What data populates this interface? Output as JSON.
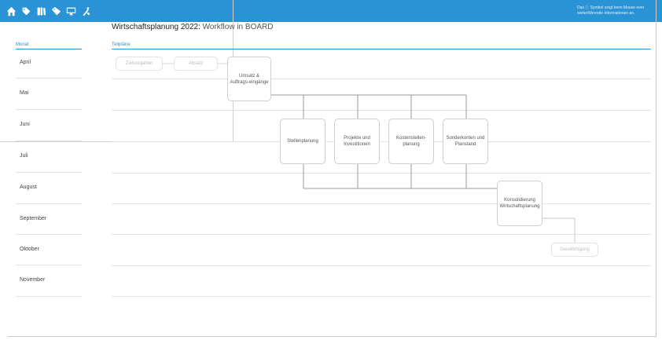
{
  "toolbar": {
    "icons": [
      "home-icon",
      "tag-icon",
      "book-icon",
      "tags-icon",
      "monitor-icon",
      "tools-icon"
    ],
    "hint": "Das ⓘ Symbol zeigt beim Mouse-over weiterführende Informationen an."
  },
  "header": {
    "title_main": "Wirtschaftsplanung 2022:",
    "title_sub": "Workflow in BOARD"
  },
  "columns": {
    "month_header": "Monat",
    "plan_header": "Teilpläne"
  },
  "months": [
    "April",
    "Mai",
    "Juni",
    "Juli",
    "August",
    "September",
    "Oktober",
    "November"
  ],
  "workflow": {
    "zielvorgaben": "Zielvorgaben",
    "absatz": "Absatz",
    "umsatz": "Umsatz & Auftrags-eingänge",
    "stellenplanung": "Stellenplanung",
    "projekte": "Projekte und Investitionen",
    "kostenstellen": "Kostenstellen-planung",
    "sonderkonten": "Sonderkonten und Planstand",
    "konsolidierung": "Konsolidierung Wirtschaftsplanung",
    "genehmigung": "Genehmigung"
  },
  "colors": {
    "accent": "#2a93d5",
    "connector": "#9a9a9a"
  }
}
